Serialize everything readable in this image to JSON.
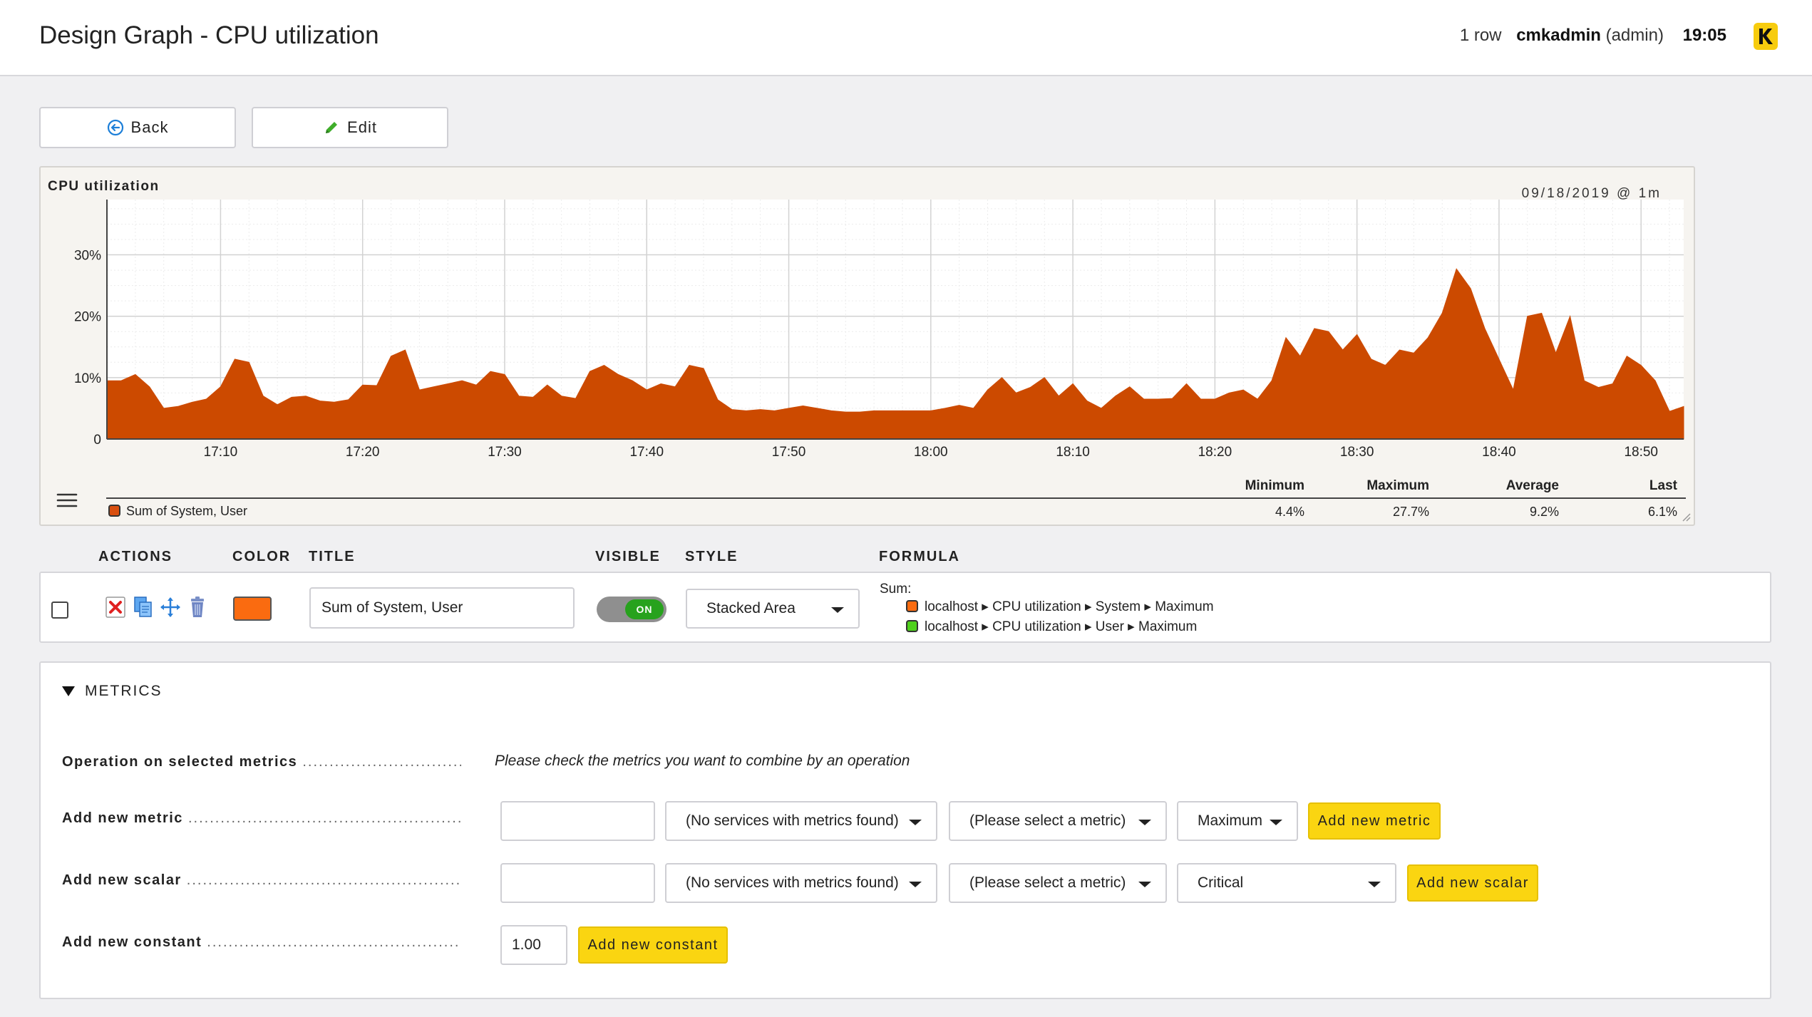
{
  "header": {
    "title": "Design Graph - CPU utilization",
    "rows": "1 row",
    "user": "cmkadmin",
    "role": "(admin)",
    "time": "19:05",
    "logo_icon": "checkmk-logo-icon"
  },
  "toolbar": {
    "back_label": "Back",
    "edit_label": "Edit"
  },
  "graph": {
    "title": "CPU utilization",
    "date": "09/18/2019 @ 1m",
    "legend_series": "Sum of System, User",
    "stats": {
      "headers": [
        "Minimum",
        "Maximum",
        "Average",
        "Last"
      ],
      "values": [
        "4.4%",
        "27.7%",
        "9.2%",
        "6.1%"
      ]
    }
  },
  "chart_data": {
    "type": "area",
    "title": "CPU utilization",
    "xlabel": "",
    "ylabel": "",
    "y_ticks": [
      "0",
      "10%",
      "20%",
      "30%"
    ],
    "x_ticks": [
      "17:10",
      "17:20",
      "17:30",
      "17:40",
      "17:50",
      "18:00",
      "18:10",
      "18:20",
      "18:30",
      "18:40",
      "18:50"
    ],
    "ylim": [
      0,
      39
    ],
    "x_minutes_range": [
      0,
      111
    ],
    "grid": true,
    "color": "#cc4a00",
    "series": [
      {
        "name": "Sum of System, User",
        "x_minutes": [
          0,
          1,
          2,
          3,
          4,
          5,
          6,
          7,
          8,
          9,
          10,
          11,
          12,
          13,
          14,
          15,
          16,
          17,
          18,
          19,
          20,
          21,
          22,
          23,
          24,
          25,
          26,
          27,
          28,
          29,
          30,
          31,
          32,
          33,
          34,
          35,
          36,
          37,
          38,
          39,
          40,
          41,
          42,
          43,
          44,
          45,
          46,
          47,
          48,
          49,
          50,
          51,
          52,
          53,
          54,
          55,
          56,
          57,
          58,
          59,
          60,
          61,
          62,
          63,
          64,
          65,
          66,
          67,
          68,
          69,
          70,
          71,
          72,
          73,
          74,
          75,
          76,
          77,
          78,
          79,
          80,
          81,
          82,
          83,
          84,
          85,
          86,
          87,
          88,
          89,
          90,
          91,
          92,
          93,
          94,
          95,
          96,
          97,
          98,
          99,
          100,
          101,
          102,
          103,
          104,
          105,
          106,
          107,
          108,
          109,
          110,
          111
        ],
        "values": [
          9.5,
          9.5,
          10.5,
          8.5,
          5,
          5.3,
          6,
          6.5,
          8.5,
          13,
          12.5,
          7,
          5.6,
          6.8,
          7,
          6.2,
          6,
          6.4,
          8.8,
          8.7,
          13.5,
          14.5,
          8,
          8.5,
          9,
          9.5,
          8.8,
          11,
          10.5,
          7,
          6.8,
          8.8,
          7,
          6.6,
          11,
          12,
          10.5,
          9.5,
          8,
          9,
          8.5,
          12,
          11.5,
          6.4,
          4.8,
          4.6,
          4.8,
          4.6,
          5,
          5.4,
          5,
          4.6,
          4.4,
          4.4,
          4.6,
          4.6,
          4.6,
          4.6,
          4.6,
          5,
          5.5,
          5,
          8,
          10,
          7.5,
          8.4,
          10,
          7,
          9,
          6.2,
          5,
          7,
          8.5,
          6.5,
          6.5,
          6.6,
          9,
          6.5,
          6.5,
          7.5,
          8,
          6.5,
          9.5,
          16.5,
          13.5,
          18,
          17.5,
          14.5,
          17,
          13,
          12,
          14.5,
          14,
          16.5,
          20.5,
          27.7,
          24.5,
          18,
          13,
          8,
          20,
          20.5,
          14,
          20,
          9.5,
          8.4,
          9,
          13.5,
          12,
          9.5,
          4.5,
          5.3,
          5.5,
          6.1
        ]
      }
    ]
  },
  "curves": {
    "headers": {
      "actions": "ACTIONS",
      "color": "COLOR",
      "title": "TITLE",
      "visible": "VISIBLE",
      "style": "STYLE",
      "formula": "FORMULA"
    },
    "row": {
      "title_value": "Sum of System, User",
      "color": "#fa6b10",
      "visible_label": "ON",
      "style_value": "Stacked Area",
      "formula_sum": "Sum:",
      "formula_items": [
        {
          "text": "localhost ▸ CPU utilization ▸ System ▸ Maximum",
          "color": "#fa6b10"
        },
        {
          "text": "localhost ▸ CPU utilization ▸ User ▸ Maximum",
          "color": "#4fd01c"
        }
      ]
    }
  },
  "metrics": {
    "heading": "METRICS",
    "operation_label": "Operation on selected metrics",
    "operation_hint": "Please check the metrics you want to combine by an operation",
    "add_metric": {
      "label": "Add new metric",
      "service_value": "(No services with metrics found)",
      "metric_value": "(Please select a metric)",
      "consolidation_value": "Maximum",
      "button": "Add new metric"
    },
    "add_scalar": {
      "label": "Add new scalar",
      "service_value": "(No services with metrics found)",
      "metric_value": "(Please select a metric)",
      "scalar_value": "Critical",
      "button": "Add new scalar"
    },
    "add_constant": {
      "label": "Add new constant",
      "value": "1.00",
      "button": "Add new constant"
    },
    "dots": "..............................................................................................."
  }
}
